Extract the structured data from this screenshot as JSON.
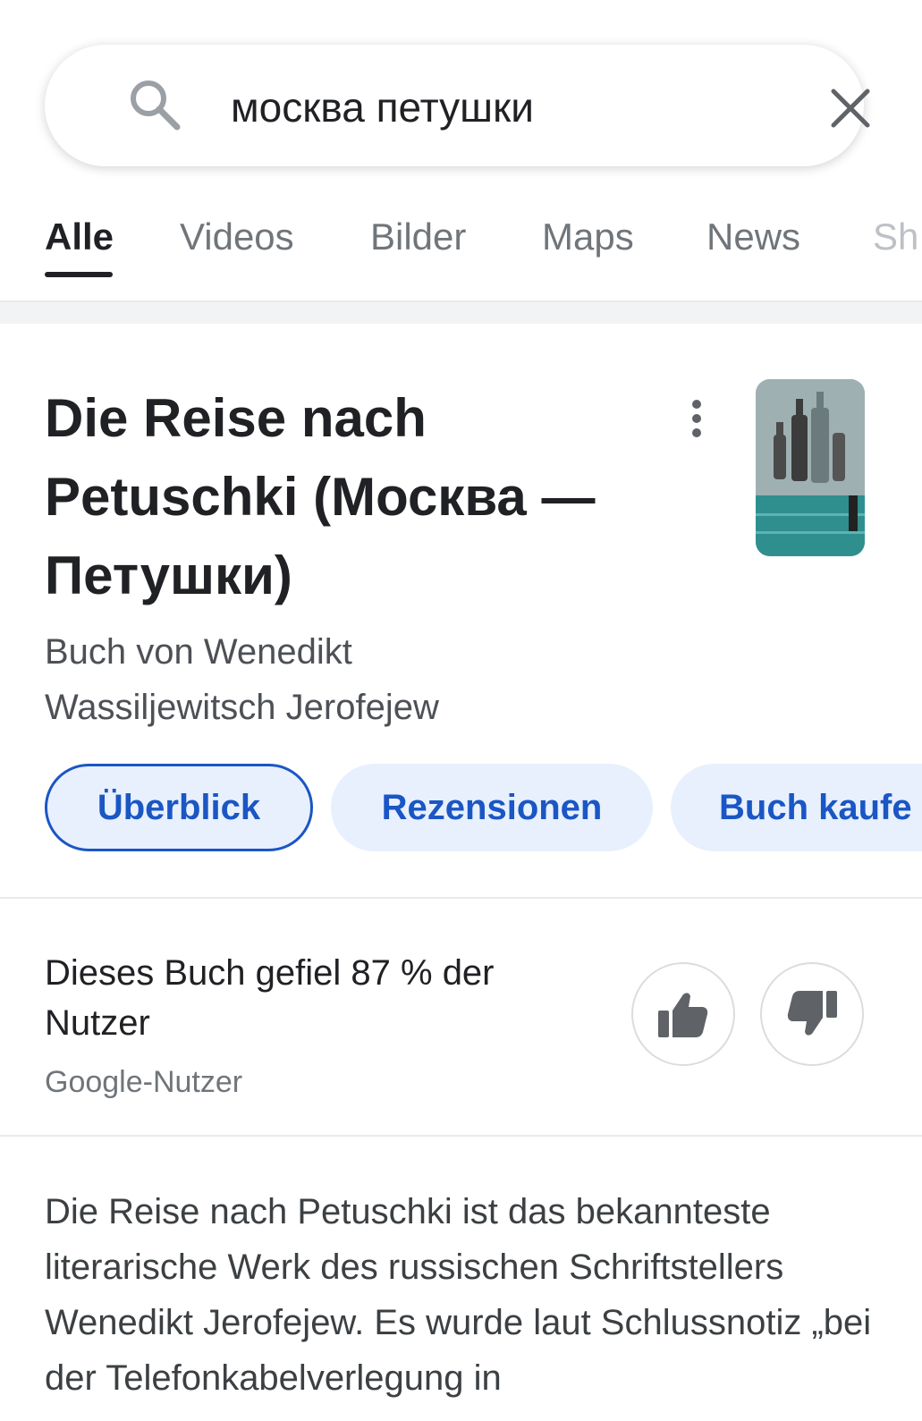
{
  "search": {
    "query": "москва петушки"
  },
  "tabs": [
    {
      "label": "Alle",
      "active": true
    },
    {
      "label": "Videos",
      "active": false
    },
    {
      "label": "Bilder",
      "active": false
    },
    {
      "label": "Maps",
      "active": false
    },
    {
      "label": "News",
      "active": false
    },
    {
      "label": "Sh",
      "active": false
    }
  ],
  "knowledge_panel": {
    "title": "Die Reise nach Petuschki (Москва — Петушки)",
    "subtitle": "Buch von Wenedikt Wassiljewitsch Jerofejew",
    "thumbnail_icon": "book-cover-image",
    "chips": [
      {
        "label": "Überblick",
        "selected": true
      },
      {
        "label": "Rezensionen",
        "selected": false
      },
      {
        "label": "Buch kaufe",
        "selected": false
      }
    ]
  },
  "rating": {
    "text": "Dieses Buch gefiel 87 % der Nutzer",
    "source": "Google-Nutzer",
    "percent": 87
  },
  "description": {
    "text": "Die Reise nach Petuschki ist das bekannteste literarische Werk des russischen Schriftstellers Wenedikt Jerofejew. Es wurde laut Schlussnotiz „bei der Telefonkabelverlegung in"
  },
  "colors": {
    "accent_blue": "#1a56c4",
    "chip_bg": "#e8f0fe",
    "text_primary": "#202124",
    "text_secondary": "#70757a"
  }
}
